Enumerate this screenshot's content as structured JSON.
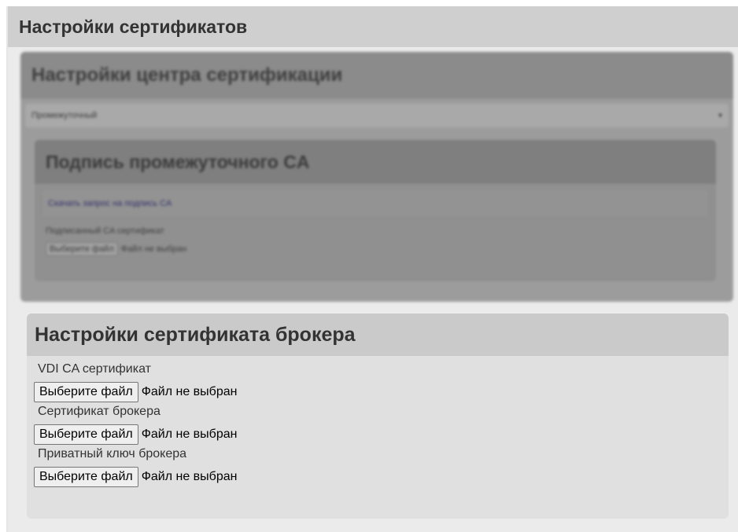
{
  "page": {
    "title": "Настройки сертификатов"
  },
  "ca_section": {
    "title": "Настройки центра сертификации",
    "select_value": "Промежуточный",
    "intermediate": {
      "title": "Подпись промежуточного CA",
      "download_link": "Скачать запрос на подпись CA",
      "signed_label": "Подписанный CA сертификат",
      "file_button": "Выберите файл",
      "file_status": "Файл не выбран"
    }
  },
  "broker_section": {
    "title": "Настройки сертификата брокера",
    "fields": [
      {
        "label": "VDI CA сертификат",
        "button": "Выберите файл",
        "status": "Файл не выбран"
      },
      {
        "label": "Сертификат брокера",
        "button": "Выберите файл",
        "status": "Файл не выбран"
      },
      {
        "label": "Приватный ключ брокера",
        "button": "Выберите файл",
        "status": "Файл не выбран"
      }
    ]
  }
}
